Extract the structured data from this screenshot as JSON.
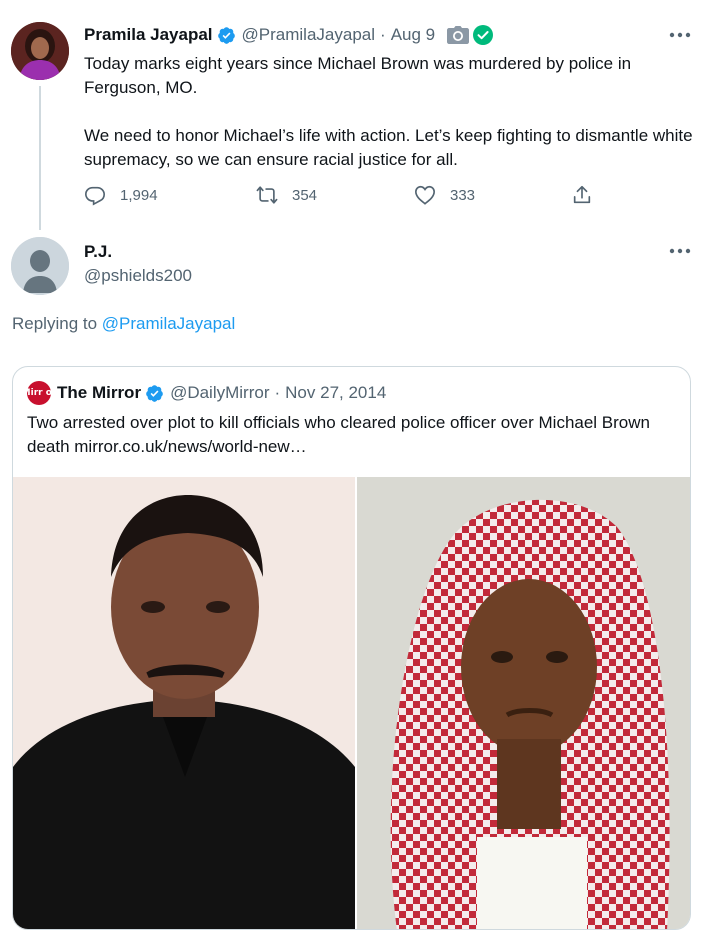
{
  "tweet": {
    "author_name": "Pramila Jayapal",
    "handle": "@PramilaJayapal",
    "date": "Aug 9",
    "paragraph1": "Today marks eight years since Michael Brown was murdered by police in Ferguson, MO.",
    "paragraph2": "We need to honor Michael’s life with action. Let’s keep fighting to dismantle white supremacy, so we can ensure racial justice for all.",
    "reply_count": "1,994",
    "retweet_count": "354",
    "like_count": "333",
    "icons": [
      "verified-badge-icon",
      "camera-icon",
      "check-green-icon",
      "more-icon",
      "reply-icon",
      "retweet-icon",
      "like-icon",
      "share-icon"
    ]
  },
  "reply": {
    "author_name": "P.J.",
    "handle": "@pshields200",
    "replying_prefix": "Replying to",
    "replying_to": "@PramilaJayapal"
  },
  "quoted": {
    "logo_text": "Mirr or",
    "author_name": "The Mirror",
    "handle": "@DailyMirror",
    "date": "Nov 27, 2014",
    "text": "Two arrested over plot to kill officials who cleared police officer over Michael Brown death mirror.co.uk/news/world-new…"
  },
  "colors": {
    "accent": "#1d9bf0",
    "text_primary": "#0f1419",
    "text_secondary": "#536471",
    "border": "#cfd9de",
    "mirror_red": "#c8102e",
    "check_green": "#00ba7c"
  }
}
